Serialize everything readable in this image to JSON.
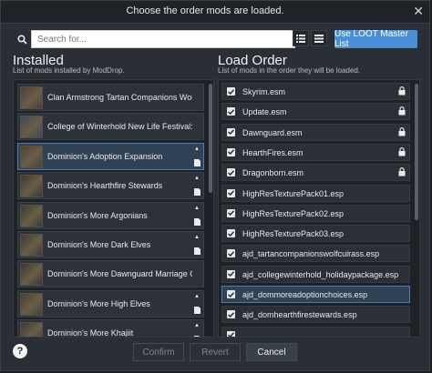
{
  "dialog": {
    "title": "Choose the order mods are loaded."
  },
  "toolbar": {
    "search_placeholder": "Search for...",
    "search_value": "",
    "loot_button_label": "Use LOOT Master List"
  },
  "installed": {
    "heading": "Installed",
    "subheading": "List of mods installed by ModDrop.",
    "items": [
      {
        "name": "Clan Armstrong Tartan Companions Wolf Cuirass",
        "icons": false,
        "thumb": "#4a4036"
      },
      {
        "name": "College of Winterhold New Life Festival: A Holiday Mod",
        "icons": false,
        "thumb": "#3f4a52"
      },
      {
        "name": "Dominion's Adoption Expansion",
        "icons": true,
        "selected": true,
        "thumb": "#4b4330"
      },
      {
        "name": "Dominion's Hearthfire Stewards",
        "icons": true,
        "thumb": "#3a3a2e"
      },
      {
        "name": "Dominion's More Argonians",
        "icons": true,
        "thumb": "#35402f"
      },
      {
        "name": "Dominion's More Dark Elves",
        "icons": true,
        "thumb": "#3e3b33"
      },
      {
        "name": "Dominion's More Dawnguard Marriage Candidates",
        "icons": false,
        "thumb": "#3b3634"
      },
      {
        "name": "Dominion's More High Elves",
        "icons": true,
        "thumb": "#44402f"
      },
      {
        "name": "Dominion's More Khajiit",
        "icons": true,
        "thumb": "#3d3a31"
      }
    ]
  },
  "load_order": {
    "heading": "Load Order",
    "subheading": "List of mods in the order they will be loaded.",
    "items": [
      {
        "name": "Skyrim.esm",
        "locked": true
      },
      {
        "name": "Update.esm",
        "locked": true
      },
      {
        "name": "Dawnguard.esm",
        "locked": true
      },
      {
        "name": "HearthFires.esm",
        "locked": true
      },
      {
        "name": "Dragonborn.esm",
        "locked": true
      },
      {
        "name": "HighResTexturePack01.esp",
        "locked": false
      },
      {
        "name": "HighResTexturePack02.esp",
        "locked": false
      },
      {
        "name": "HighResTexturePack03.esp",
        "locked": false
      },
      {
        "name": "ajd_tartancompanionswolfcuirass.esp",
        "locked": false
      },
      {
        "name": "ajd_collegewinterhold_holidaypackage.esp",
        "locked": false
      },
      {
        "name": "ajd_dommoreadoptionchoices.esp",
        "locked": false,
        "selected": true
      },
      {
        "name": "ajd_domhearthfirestewards.esp",
        "locked": false
      },
      {
        "name": "",
        "locked": false
      }
    ]
  },
  "footer": {
    "help_label": "?",
    "confirm_label": "Confirm",
    "revert_label": "Revert",
    "cancel_label": "Cancel"
  },
  "colors": {
    "accent": "#4a90d9",
    "selected_border": "#4a7fb5",
    "panel_bg": "#1e2226"
  }
}
